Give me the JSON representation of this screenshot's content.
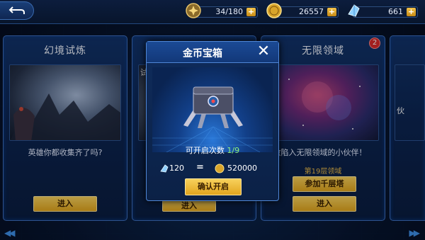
{
  "topbar": {
    "stamina": "34/180",
    "gold": "26557",
    "crystal": "661",
    "plus": "+"
  },
  "cards": [
    {
      "title": "幻境试炼",
      "desc": "英雄你都收集齐了吗?",
      "btn": "进入"
    },
    {
      "title": "",
      "desc": "",
      "btn": "进入",
      "overlay_text": "试"
    },
    {
      "title": "无限领域",
      "desc": "拯救陷入无限领域的小伙伴！",
      "floor": "第19层领域",
      "btn_tower": "参加千层塔",
      "btn": "进入",
      "badge": "2"
    },
    {
      "title": "",
      "desc": "",
      "overlay_text": "伙"
    }
  ],
  "modal": {
    "title": "金币宝箱",
    "close": "✕",
    "open_label": "可开启次数",
    "open_count": "1/9",
    "crystal_cost": "120",
    "equals": "=",
    "gold_amount": "520000",
    "confirm": "确认开启"
  },
  "nav": {
    "left": "◀◀",
    "right": "▶▶"
  },
  "colors": {
    "gold": "#f0b52c",
    "accent": "#4f86d6",
    "count": "#8ef07a"
  }
}
